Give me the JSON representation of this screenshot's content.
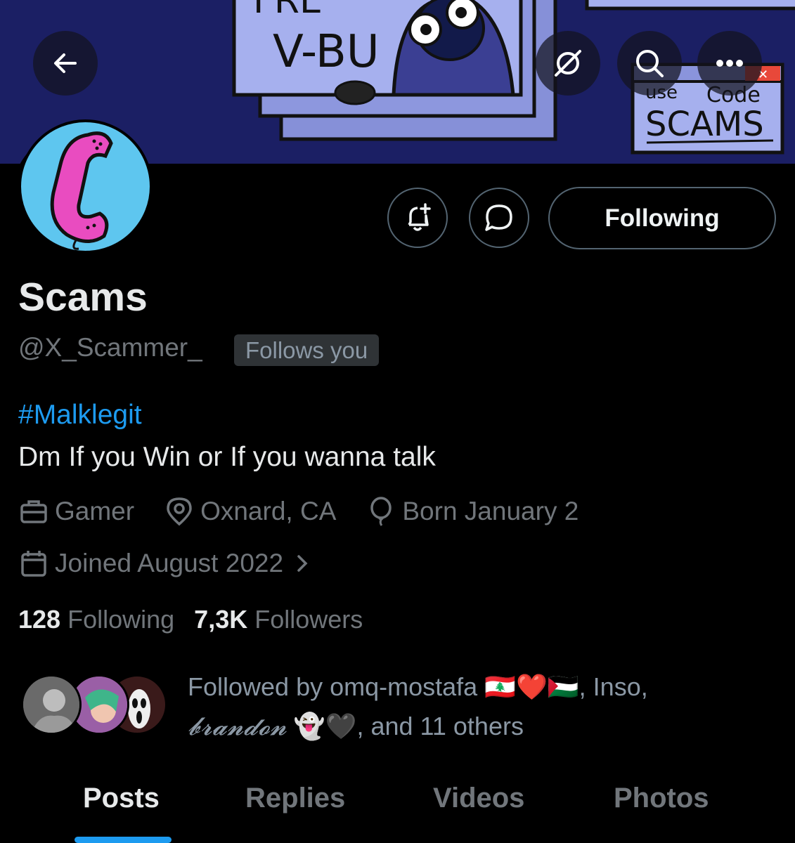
{
  "banner": {
    "sign_text": "V-BU",
    "sign_text_top": "FRE",
    "code_window_line1_a": "use",
    "code_window_line1_b": "Code",
    "code_window_line2": "SCAMS"
  },
  "toolbar": {
    "back_icon": "arrow-left-icon",
    "grok_icon": "slash-circle-icon",
    "search_icon": "search-icon",
    "more_icon": "more-icon"
  },
  "actions": {
    "notify_icon": "bell-plus-icon",
    "message_icon": "message-bubble-icon",
    "following_label": "Following"
  },
  "profile": {
    "name": "Scams",
    "handle": "@X_Scammer_",
    "follows_you": "Follows you",
    "hashtag": "#Malklegit",
    "bio": "Dm If you Win or If you wanna talk",
    "profession": "Gamer",
    "location": "Oxnard, CA",
    "birthday": "Born January 2",
    "joined": "Joined August 2022"
  },
  "stats": {
    "following_count": "128",
    "following_label": "Following",
    "followers_count": "7,3K",
    "followers_label": "Followers"
  },
  "followed_by": {
    "prefix": "Followed by omq-mostafa",
    "emojis1": "🇱🇧❤️🇵🇸",
    "name2": ", Inso,",
    "name3": "𝓫𝓻𝓪𝓷𝓭𝓸𝓷",
    "emojis2": "👻🖤",
    "suffix": ", and 11 others"
  },
  "tabs": [
    {
      "label": "Posts",
      "active": true
    },
    {
      "label": "Replies",
      "active": false
    },
    {
      "label": "Videos",
      "active": false
    },
    {
      "label": "Photos",
      "active": false
    }
  ],
  "colors": {
    "accent": "#1d9bf0",
    "banner": "#1b1f64",
    "avatar_bg": "#5ec6ef",
    "phone_pink": "#e94cc0"
  }
}
